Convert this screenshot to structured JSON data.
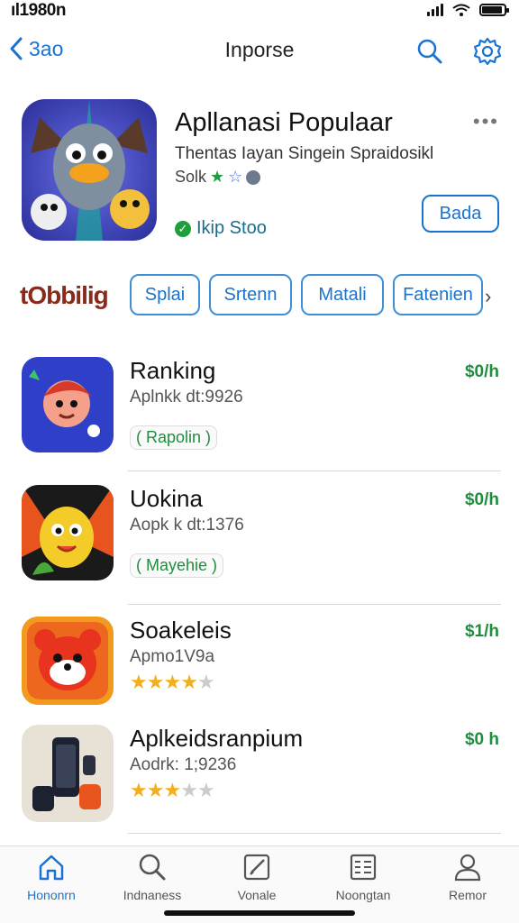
{
  "status": {
    "time": "ıl1980n"
  },
  "nav": {
    "back_label": "3ao",
    "title": "Inporse"
  },
  "featured": {
    "title": "Apllanasi Populaar",
    "subtitle": "Thentas Iayan Singein Spraidosikl",
    "rating_text": "Solk",
    "store_label": "Ikip Stoo",
    "get_label": "Bada",
    "more_label": "•••"
  },
  "categories": {
    "brand": "tObbilig",
    "chips": [
      "Splai",
      "Srtenn",
      "Matali",
      "Fatenien"
    ]
  },
  "apps": [
    {
      "name": "Ranking",
      "meta": "Aplnkk dt:9926",
      "price": "$0/h",
      "tag": "( Rapolin )"
    },
    {
      "name": "Uokina",
      "meta": "Aopk k dt:1376",
      "price": "$0/h",
      "tag": "( Mayehie )"
    },
    {
      "name": "Soakeleis",
      "meta": "Apmo1V9a",
      "price": "$1/h",
      "stars": 4
    },
    {
      "name": "Aplkeidsranpium",
      "meta": "Aodrk: 1;9236",
      "price": "$0 h",
      "stars": 3
    }
  ],
  "tabs": [
    {
      "label": "Hononrn",
      "icon": "home-icon"
    },
    {
      "label": "Indnaness",
      "icon": "search-icon"
    },
    {
      "label": "Vonale",
      "icon": "edit-icon"
    },
    {
      "label": "Noongtan",
      "icon": "list-icon"
    },
    {
      "label": "Remor",
      "icon": "person-icon"
    }
  ],
  "colors": {
    "accent": "#1a73d1",
    "price": "#1e8e3e",
    "star": "#f2b01e"
  }
}
